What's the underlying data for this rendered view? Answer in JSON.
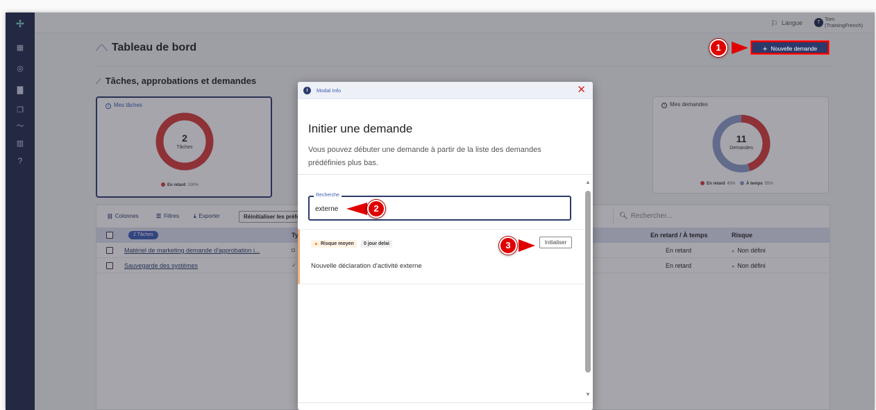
{
  "topbar": {
    "language_label": "Langue",
    "user_initial": "T",
    "user_name_line1": "Tom",
    "user_name_line2": "(TrainingFrench)"
  },
  "page": {
    "title": "Tableau de bord",
    "new_request_button": "Nouvelle demande",
    "section_title": "Tâches, approbations et demandes"
  },
  "cards": {
    "tasks": {
      "label": "Mes tâches",
      "count": "2",
      "sublabel": "Tâches",
      "legend_late": "En retard",
      "legend_late_pct": "100%"
    },
    "requests": {
      "label": "Mes demandes",
      "count": "11",
      "sublabel": "Demandes",
      "legend_late": "En retard",
      "legend_late_pct": "45%",
      "legend_ontime": "À temps",
      "legend_ontime_pct": "55%"
    }
  },
  "table": {
    "toolbar": {
      "columns": "Colonnes",
      "filters": "Filtres",
      "export": "Exporter",
      "reset": "Réinitialiser les préférences",
      "search_placeholder": "Rechercher..."
    },
    "header": {
      "tasks_pill": "2 Tâches",
      "type": "Typ",
      "late_ontime": "En retard / À temps",
      "risk": "Risque"
    },
    "rows": [
      {
        "name": "Matériel de marketing demande d'approbation i...",
        "status": "En retard",
        "risk": "Non défini"
      },
      {
        "name": "Sauvegarde des systèmes",
        "status": "En retard",
        "risk": "Non défini"
      }
    ]
  },
  "modal": {
    "header_label": "Modal Info",
    "title": "Initier une demande",
    "description": "Vous pouvez débuter une demande à partir de la liste des demandes prédéfinies plus bas.",
    "search_label": "Recherche",
    "search_value": "externe",
    "result": {
      "risk_badge": "Risque moyen",
      "delay_badge": "0 jour delai",
      "init_button": "Initialiser",
      "text": "Nouvelle déclaration d'activité externe"
    }
  },
  "callouts": [
    "1",
    "2",
    "3"
  ],
  "colors": {
    "sidebar": "#1f2a4a",
    "primary": "#2c3a6b",
    "accent_blue": "#3b5bb5",
    "late_red": "#d83a3a",
    "ontime_blue": "#8c9cc8",
    "callout_red": "#e00000"
  },
  "icons": [
    "logo-icon",
    "chart-icon",
    "check-circle-icon",
    "chat-icon",
    "copy-icon",
    "trend-icon",
    "building-icon",
    "help-icon",
    "flag-icon",
    "close-icon",
    "info-icon",
    "columns-icon",
    "filter-icon",
    "export-icon",
    "search-icon",
    "warning-icon"
  ]
}
